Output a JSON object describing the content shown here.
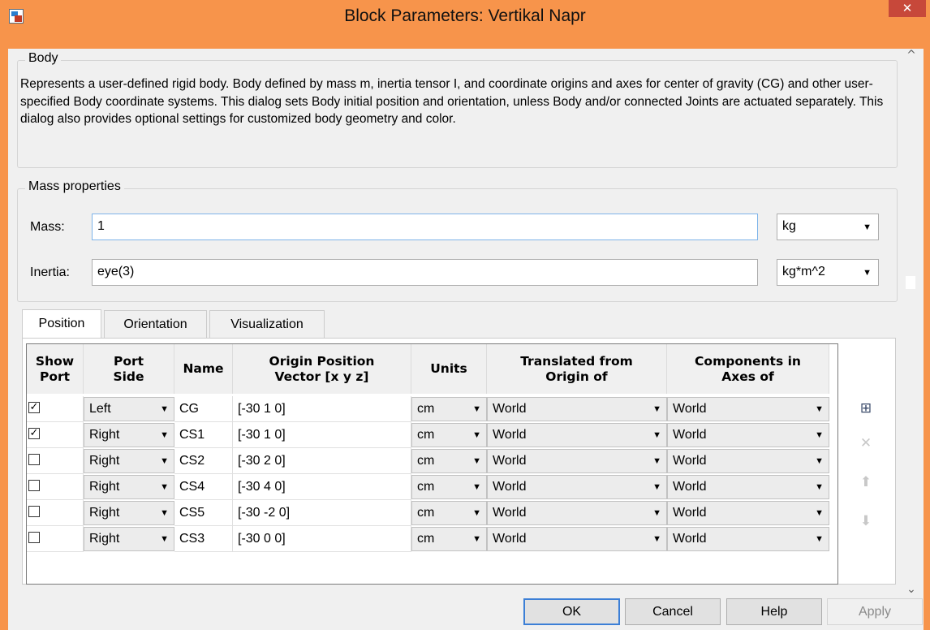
{
  "window": {
    "title": "Block Parameters: Vertikal Napr",
    "close_glyph": "✕",
    "icon": "simulink-block-icon"
  },
  "body_section": {
    "label": "Body",
    "description": "Represents a user-defined rigid body. Body defined by mass m, inertia tensor I, and coordinate origins and axes for center of gravity (CG) and other user-specified Body coordinate systems. This dialog sets Body initial position and orientation, unless Body and/or connected Joints are actuated separately. This dialog also provides optional settings for customized body geometry and color."
  },
  "mass_properties": {
    "label": "Mass properties",
    "mass": {
      "label": "Mass:",
      "value": "1",
      "unit": "kg"
    },
    "inertia": {
      "label": "Inertia:",
      "value": "eye(3)",
      "unit": "kg*m^2"
    }
  },
  "tabs": [
    {
      "label": "Position",
      "active": true
    },
    {
      "label": "Orientation",
      "active": false
    },
    {
      "label": "Visualization",
      "active": false
    }
  ],
  "table": {
    "headers": [
      "Show\nPort",
      "Port\nSide",
      "Name",
      "Origin Position\nVector [x y z]",
      "Units",
      "Translated from\nOrigin of",
      "Components in\nAxes of"
    ],
    "rows": [
      {
        "show": true,
        "side": "Left",
        "name": "CG",
        "vector": "[-30 1 0]",
        "units": "cm",
        "translated": "World",
        "components": "World"
      },
      {
        "show": true,
        "side": "Right",
        "name": "CS1",
        "vector": "[-30 1 0]",
        "units": "cm",
        "translated": "World",
        "components": "World"
      },
      {
        "show": false,
        "side": "Right",
        "name": "CS2",
        "vector": "[-30 2 0]",
        "units": "cm",
        "translated": "World",
        "components": "World"
      },
      {
        "show": false,
        "side": "Right",
        "name": "CS4",
        "vector": "[-30 4 0]",
        "units": "cm",
        "translated": "World",
        "components": "World"
      },
      {
        "show": false,
        "side": "Right",
        "name": "CS5",
        "vector": "[-30 -2 0]",
        "units": "cm",
        "translated": "World",
        "components": "World"
      },
      {
        "show": false,
        "side": "Right",
        "name": "CS3",
        "vector": "[-30 0 0]",
        "units": "cm",
        "translated": "World",
        "components": "World"
      }
    ]
  },
  "side_buttons": [
    {
      "icon": "add-row-icon",
      "glyph": "⊞",
      "enabled": true
    },
    {
      "icon": "delete-row-icon",
      "glyph": "✕",
      "enabled": false
    },
    {
      "icon": "move-up-icon",
      "glyph": "⬆",
      "enabled": false
    },
    {
      "icon": "move-down-icon",
      "glyph": "⬇",
      "enabled": false
    }
  ],
  "buttons": {
    "ok": "OK",
    "cancel": "Cancel",
    "help": "Help",
    "apply": "Apply"
  },
  "colors": {
    "title_bar": "#f7944b",
    "close_button": "#c7483a",
    "default_button_border": "#3c7fd6"
  }
}
